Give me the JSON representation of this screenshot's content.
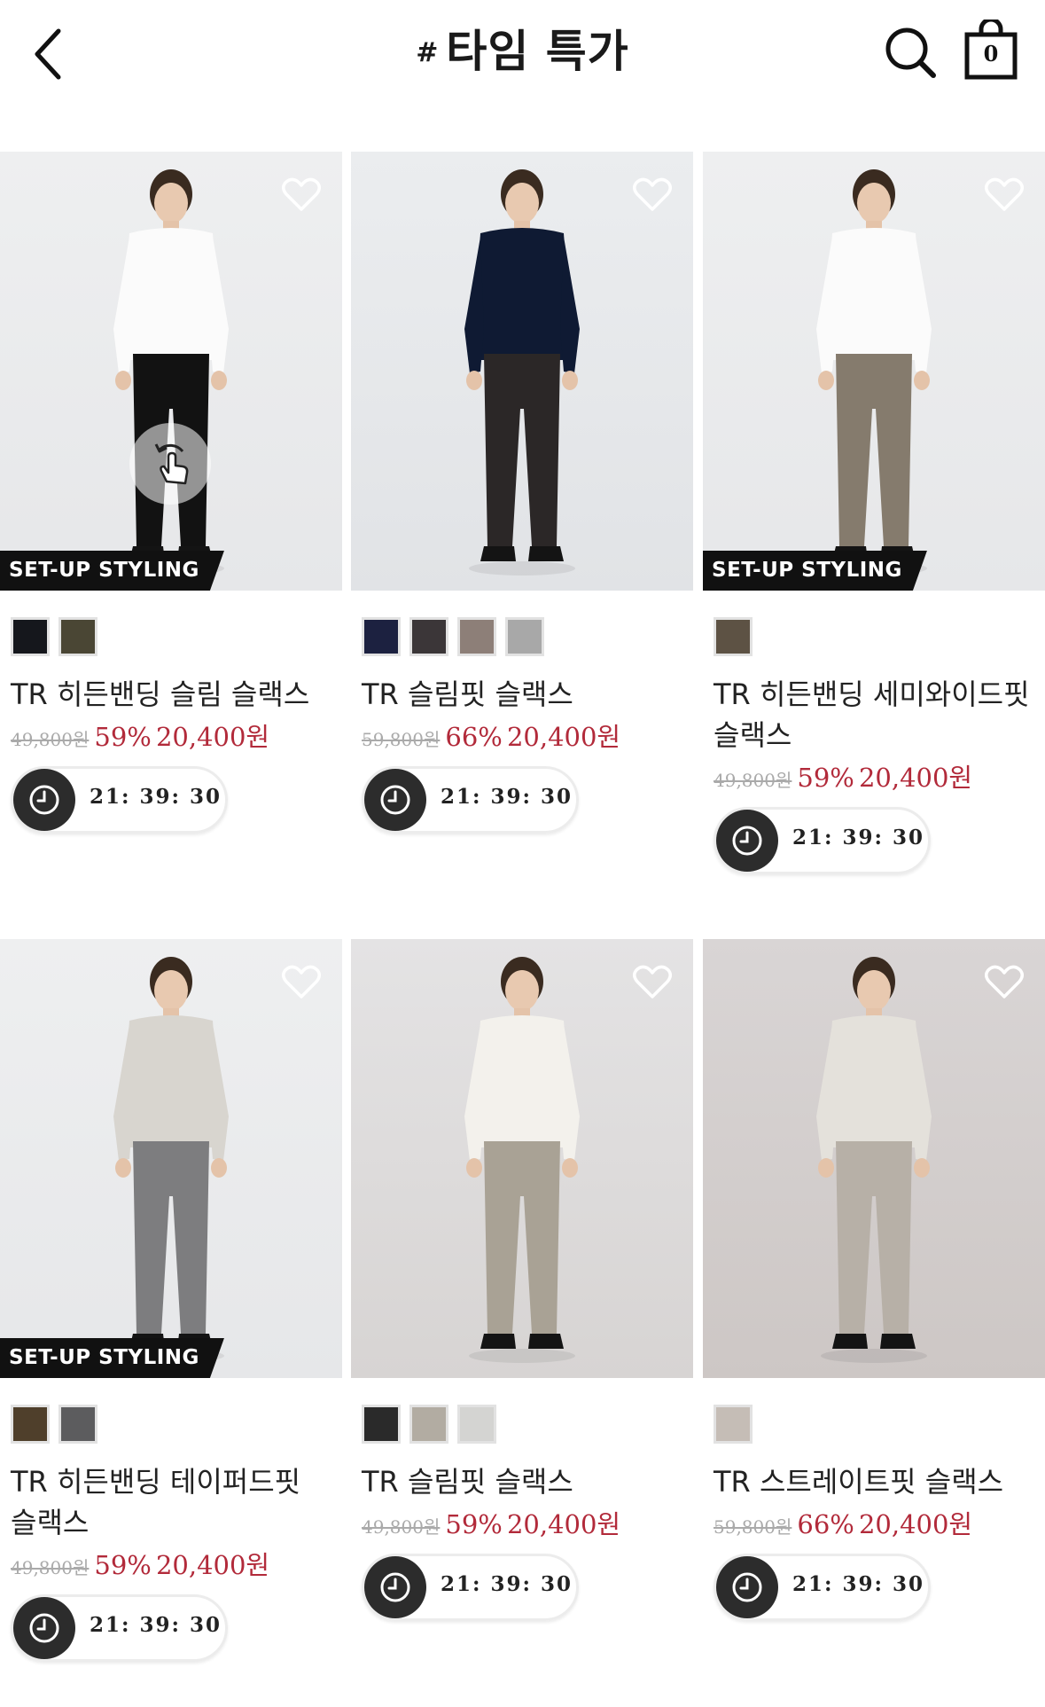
{
  "header": {
    "hash": "#",
    "title": "타임 특가",
    "cart_count": "0"
  },
  "products": [
    {
      "name": "TR 히든밴딩 슬림 슬랙스",
      "original_price": "49,800원",
      "discount": "59%",
      "sale_price": "20,400원",
      "timer": "21: 39: 30",
      "badge": "SET-UP STYLING",
      "swatches": [
        "#15171c",
        "#4a4634"
      ],
      "top": "#fbfbfb",
      "pants": "#121212"
    },
    {
      "name": "TR 슬림핏 슬랙스",
      "original_price": "59,800원",
      "discount": "66%",
      "sale_price": "20,400원",
      "timer": "21: 39: 30",
      "badge": "",
      "swatches": [
        "#1c2140",
        "#3b3638",
        "#8d7f78",
        "#a8a8a8"
      ],
      "top": "#0f1a33",
      "pants": "#2b2727"
    },
    {
      "name": "TR 히든밴딩 세미와이드핏 슬랙스",
      "original_price": "49,800원",
      "discount": "59%",
      "sale_price": "20,400원",
      "timer": "21: 39: 30",
      "badge": "SET-UP STYLING",
      "swatches": [
        "#5d5244"
      ],
      "top": "#fbfbfb",
      "pants": "#857b6d"
    },
    {
      "name": "TR 히든밴딩 테이퍼드핏 슬랙스",
      "original_price": "49,800원",
      "discount": "59%",
      "sale_price": "20,400원",
      "timer": "21: 39: 30",
      "badge": "SET-UP STYLING",
      "swatches": [
        "#4f3f2b",
        "#5c5c5e"
      ],
      "top": "#d8d5cf",
      "pants": "#7d7d7f"
    },
    {
      "name": "TR 슬림핏 슬랙스",
      "original_price": "49,800원",
      "discount": "59%",
      "sale_price": "20,400원",
      "timer": "21: 39: 30",
      "badge": "",
      "swatches": [
        "#2a2a2a",
        "#b2aca2",
        "#d4d4d2"
      ],
      "top": "#f3f1ec",
      "pants": "#a9a295"
    },
    {
      "name": "TR 스트레이트핏 슬랙스",
      "original_price": "59,800원",
      "discount": "66%",
      "sale_price": "20,400원",
      "timer": "21: 39: 30",
      "badge": "",
      "swatches": [
        "#c5bdb6"
      ],
      "top": "#e4e1db",
      "pants": "#b7b0a7"
    }
  ]
}
